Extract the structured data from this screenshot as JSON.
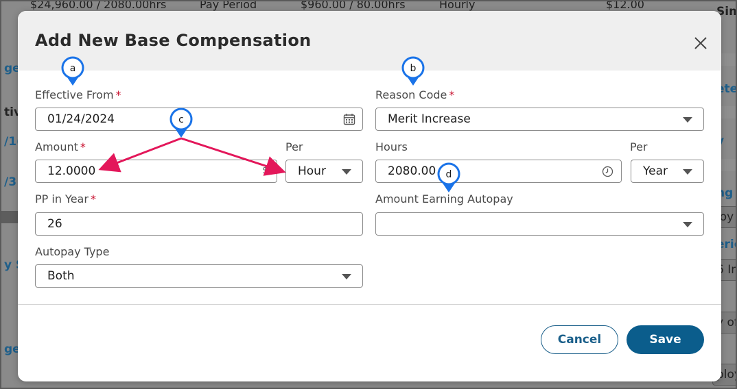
{
  "background": {
    "top_row": [
      "$24,960.00 / 2080.00hrs",
      "Pay Period",
      "$960.00 / 80.00hrs",
      "Hourly",
      "$12.00"
    ],
    "left_fragments": [
      "ge",
      "tiv",
      "/1(",
      "/3",
      "y S",
      "ge"
    ],
    "right_fragments": [
      "Simp",
      "s",
      "ose",
      "ete",
      "ose",
      "y",
      "ose",
      "ng",
      "loy",
      "erio",
      "6 In",
      "y of",
      "ploy"
    ]
  },
  "modal": {
    "title": "Add New Base Compensation",
    "fields": {
      "effective_from": {
        "label": "Effective From",
        "required": "*",
        "value": "01/24/2024"
      },
      "reason_code": {
        "label": "Reason Code",
        "required": "*",
        "value": "Merit Increase"
      },
      "amount": {
        "label": "Amount",
        "required": "*",
        "value": "12.0000",
        "suffix": "$"
      },
      "per_amount": {
        "label": "Per",
        "value": "Hour"
      },
      "hours": {
        "label": "Hours",
        "value": "2080.00"
      },
      "per_hours": {
        "label": "Per",
        "value": "Year"
      },
      "pp_in_year": {
        "label": "PP in Year",
        "required": "*",
        "value": "26"
      },
      "amount_earning_autopay": {
        "label": "Amount Earning Autopay",
        "value": ""
      },
      "autopay_type": {
        "label": "Autopay Type",
        "value": "Both"
      }
    },
    "buttons": {
      "cancel": "Cancel",
      "save": "Save"
    }
  },
  "annotations": {
    "a": "a",
    "b": "b",
    "c": "c",
    "d": "d"
  },
  "colors": {
    "primary": "#0b5d8c",
    "required": "#c8102e",
    "callout": "#1a73e8",
    "arrow": "#e3175a"
  }
}
